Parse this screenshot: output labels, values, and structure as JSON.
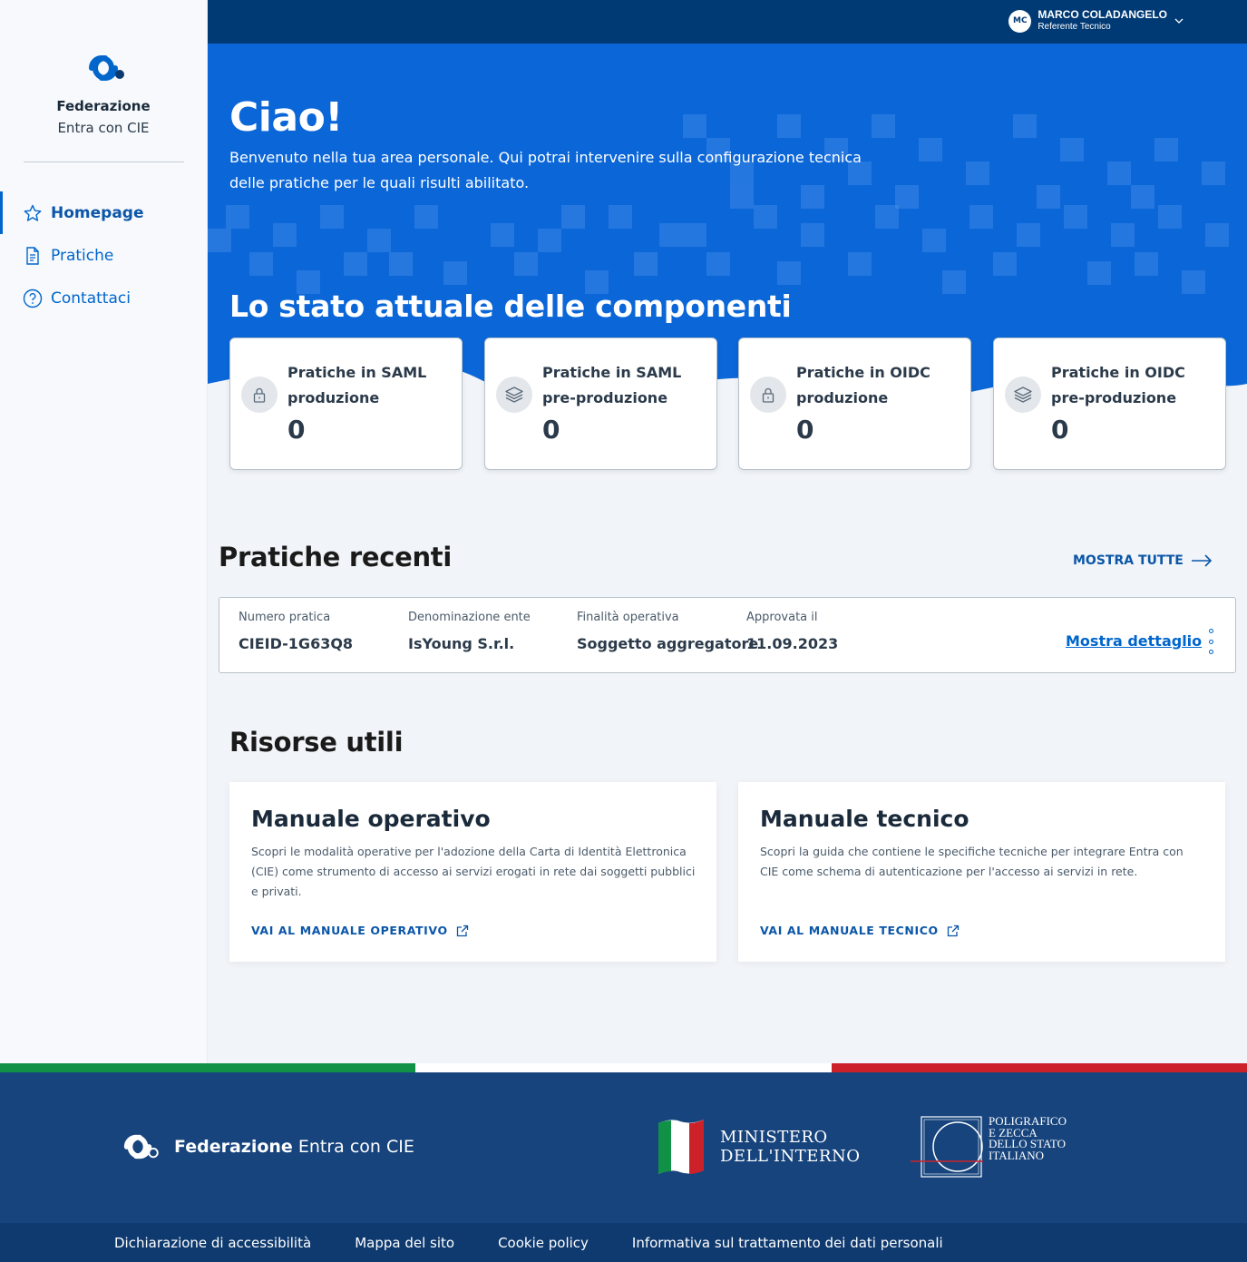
{
  "sidebar": {
    "brand_title": "Federazione",
    "brand_subtitle": "Entra con CIE",
    "items": [
      {
        "label": "Homepage",
        "icon": "star-icon"
      },
      {
        "label": "Pratiche",
        "icon": "document-icon"
      },
      {
        "label": "Contattaci",
        "icon": "help-icon"
      }
    ]
  },
  "topbar": {
    "initials": "MC",
    "user_name": "MARCO COLADANGELO",
    "user_role": "Referente Tecnico"
  },
  "hero": {
    "title": "Ciao!",
    "text": "Benvenuto nella tua area personale. Qui potrai intervenire sulla configurazione tecnica delle pratiche per le quali risulti abilitato.",
    "status_title": "Lo stato attuale delle componenti"
  },
  "stats": [
    {
      "label": "Pratiche in SAML produzione",
      "value": "0",
      "icon": "lock-icon"
    },
    {
      "label": "Pratiche in SAML pre-produzione",
      "value": "0",
      "icon": "layers-icon"
    },
    {
      "label": "Pratiche in OIDC produzione",
      "value": "0",
      "icon": "lock-icon"
    },
    {
      "label": "Pratiche in OIDC pre-produzione",
      "value": "0",
      "icon": "layers-icon"
    }
  ],
  "recent": {
    "title": "Pratiche recenti",
    "show_all": "MOSTRA TUTTE",
    "columns": [
      "Numero pratica",
      "Denominazione ente",
      "Finalità operativa",
      "Approvata il"
    ],
    "row": {
      "numero": "CIEID-1G63Q8",
      "ente": "IsYoung S.r.l.",
      "finalita": "Soggetto aggregatore",
      "approvata": "11.09.2023",
      "detail_link": "Mostra dettaglio"
    }
  },
  "resources": {
    "title": "Risorse utili",
    "cards": [
      {
        "title": "Manuale operativo",
        "text": "Scopri le modalità operative per l'adozione della Carta di Identità Elettronica (CIE) come strumento di accesso ai servizi erogati in rete dai soggetti pubblici e privati.",
        "link": "VAI AL MANUALE OPERATIVO"
      },
      {
        "title": "Manuale tecnico",
        "text": "Scopri la guida che contiene le specifiche tecniche per integrare Entra con CIE come schema di autenticazione per l'accesso ai servizi in rete.",
        "link": "VAI AL MANUALE TECNICO"
      }
    ]
  },
  "footer": {
    "brand_bold": "Federazione",
    "brand_rest": "Entra con CIE",
    "ministero_line1": "MINISTERO",
    "ministero_line2": "DELL'INTERNO",
    "poligrafico_lines": [
      "POLIGRAFICO",
      "E ZECCA",
      "DELLO STATO",
      "ITALIANO"
    ],
    "links": [
      "Dichiarazione di accessibilità",
      "Mappa del sito",
      "Cookie policy",
      "Informativa sul trattamento dei dati personali"
    ]
  },
  "colors": {
    "primary": "#0066cc",
    "hero": "#0b66d8",
    "topbar": "#003a74",
    "footer": "#17447d",
    "flag_green": "#119146",
    "flag_white": "#ffffff",
    "flag_red": "#cd212a"
  }
}
